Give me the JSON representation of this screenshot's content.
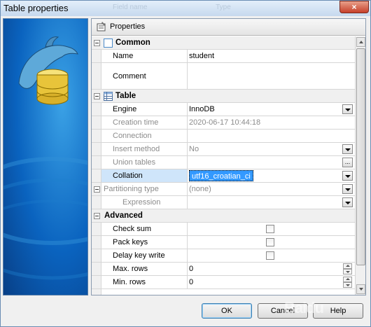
{
  "window": {
    "title": "Table properties",
    "close_glyph": "×",
    "ghost_columns": [
      "Field name",
      "Type"
    ]
  },
  "header": {
    "label": "Properties"
  },
  "categories": {
    "common": "Common",
    "table": "Table",
    "advanced": "Advanced"
  },
  "rows": {
    "name": {
      "label": "Name",
      "value": "student"
    },
    "comment": {
      "label": "Comment",
      "value": ""
    },
    "engine": {
      "label": "Engine",
      "value": "InnoDB"
    },
    "creation_time": {
      "label": "Creation time",
      "value": "2020-06-17 10:44:18"
    },
    "connection": {
      "label": "Connection",
      "value": ""
    },
    "insert_method": {
      "label": "Insert method",
      "value": "No"
    },
    "union_tables": {
      "label": "Union tables",
      "value": "",
      "button": "..."
    },
    "collation": {
      "label": "Collation",
      "value": "utf16_croatian_ci"
    },
    "partitioning": {
      "label": "Partitioning type",
      "value": "(none)"
    },
    "expression": {
      "label": "Expression",
      "value": ""
    },
    "check_sum": {
      "label": "Check sum",
      "checked": false
    },
    "pack_keys": {
      "label": "Pack keys",
      "checked": false
    },
    "delay_key_write": {
      "label": "Delay key write",
      "checked": false
    },
    "max_rows": {
      "label": "Max. rows",
      "value": "0"
    },
    "min_rows": {
      "label": "Min. rows",
      "value": "0"
    }
  },
  "buttons": {
    "ok": "OK",
    "cancel": "Cancel",
    "help": "Help"
  },
  "watermark": "Baidu",
  "colors": {
    "selection": "#3399ff",
    "selected_row": "#cfe5fa",
    "disabled_text": "#8c8c8c",
    "logo_blue": "#0a63bf"
  }
}
